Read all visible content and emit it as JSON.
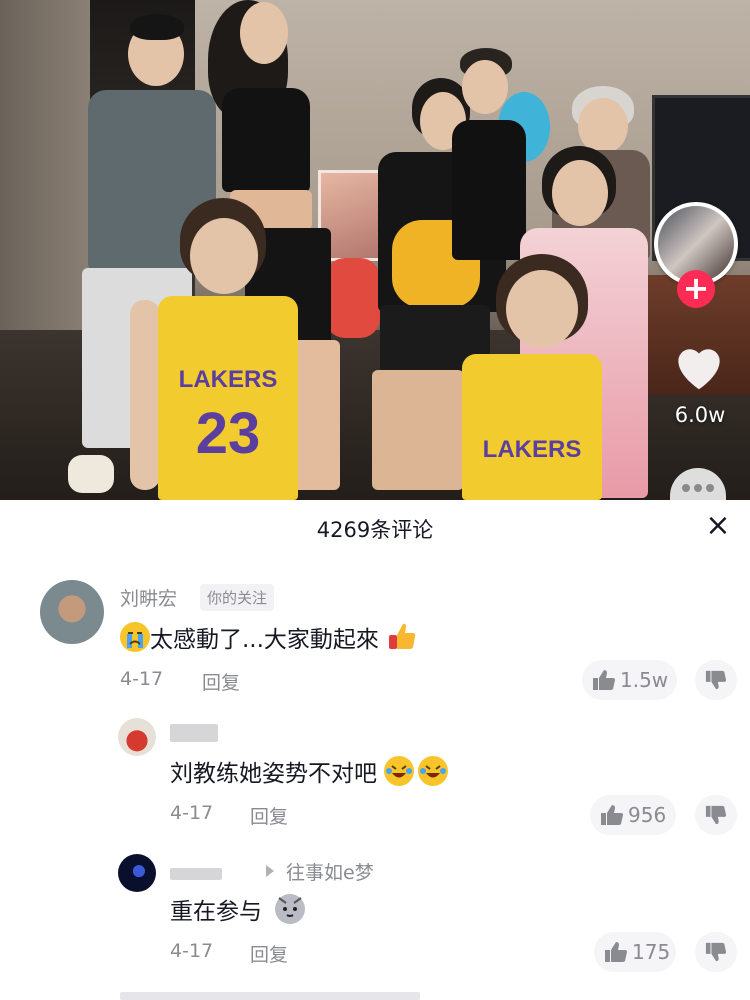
{
  "video": {
    "jersey_text": "LAKERS",
    "jersey_number": "23",
    "like_count": "6.0w"
  },
  "comments_sheet": {
    "title": "4269条评论",
    "close_icon": "×"
  },
  "comments": [
    {
      "author": "刘畊宏",
      "tag": "你的关注",
      "text": "太感動了...大家動起來",
      "emoji_before": "crying-face",
      "emoji_after": "thumbs-up",
      "date": "4-17",
      "reply_label": "回复",
      "likes": "1.5w"
    },
    {
      "author": "",
      "text": "刘教练她姿势不对吧",
      "emoji_after": "rofl-face",
      "date": "4-17",
      "reply_label": "回复",
      "likes": "956"
    },
    {
      "author": "往事如e梦",
      "text": "重在参与",
      "emoji_after": "cat-face",
      "date": "4-17",
      "reply_label": "回复",
      "likes": "175"
    }
  ],
  "colors": {
    "accent": "#fe2c55",
    "jersey": "#f2cc2e",
    "jersey_text": "#5b3fa0"
  }
}
